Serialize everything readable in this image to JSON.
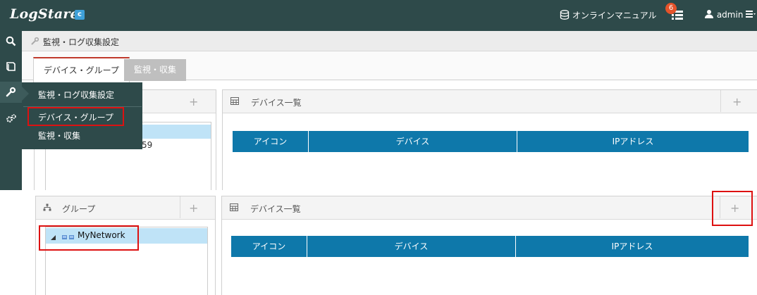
{
  "header": {
    "logo_text": "LogStare",
    "logo_mark": "c",
    "manual_label": "オンラインマニュアル",
    "notifications_count": "6",
    "user_label": "admin"
  },
  "breadcrumb": {
    "label": "監視・ログ収集設定"
  },
  "tabs": [
    {
      "label": "デバイス・グループ"
    },
    {
      "label": "監視・収集"
    }
  ],
  "menu": {
    "title": "監視・ログ収集設定",
    "items": [
      {
        "label": "デバイス・グループ"
      },
      {
        "label": "監視・収集"
      }
    ]
  },
  "top": {
    "tree_partial": "59",
    "device_panel_title": "デバイス一覧",
    "columns": [
      "アイコン",
      "デバイス",
      "IPアドレス"
    ]
  },
  "bottom": {
    "group_panel_title": "グループ",
    "tree_root": "MyNetwork",
    "device_panel_title": "デバイス一覧",
    "columns": [
      "アイコン",
      "デバイス",
      "IPアドレス"
    ]
  },
  "plus_symbol": "+",
  "colors": {
    "header": "#2e4a4a",
    "table_header": "#0e78aa",
    "highlight": "#d11111",
    "tree_select": "#bfe3f7"
  }
}
